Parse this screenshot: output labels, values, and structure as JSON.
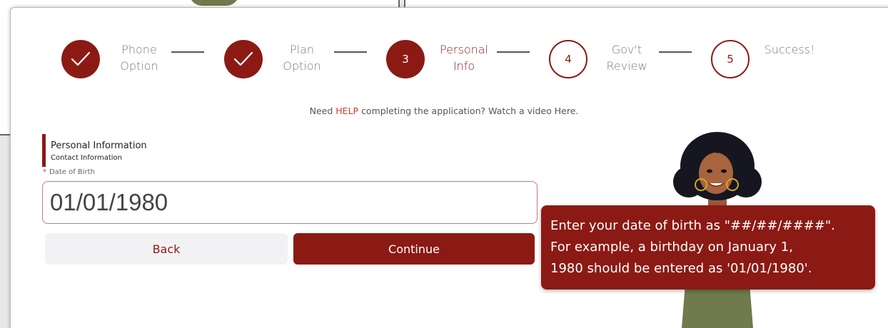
{
  "stepper": [
    {
      "number": "",
      "label_line1": "Phone",
      "label_line2": "Option",
      "state": "done"
    },
    {
      "number": "",
      "label_line1": "Plan",
      "label_line2": "Option",
      "state": "done"
    },
    {
      "number": "3",
      "label_line1": "Personal",
      "label_line2": "Info",
      "state": "active"
    },
    {
      "number": "4",
      "label_line1": "Gov't",
      "label_line2": "Review",
      "state": "todo"
    },
    {
      "number": "5",
      "label_line1": "Success!",
      "label_line2": "",
      "state": "todo"
    }
  ],
  "help": {
    "prefix": "Need ",
    "link": "HELP",
    "suffix": " completing the application? Watch a video Here."
  },
  "section": {
    "title": "Personal Information",
    "subtitle": "Contact Information"
  },
  "form": {
    "required_marker": "*",
    "dob_label": "Date of Birth",
    "dob_value": "01/01/1980"
  },
  "buttons": {
    "back": "Back",
    "continue": "Continue"
  },
  "tooltip": {
    "line1": "Enter your date of birth as \"##/##/####\".",
    "line2": "For example, a birthday on January 1,",
    "line3": "1980 should be entered as '01/01/1980'."
  },
  "colors": {
    "brand": "#8b1a14",
    "help_link": "#d23b2d"
  },
  "icons": {
    "completed_step": "checkmark-icon"
  }
}
